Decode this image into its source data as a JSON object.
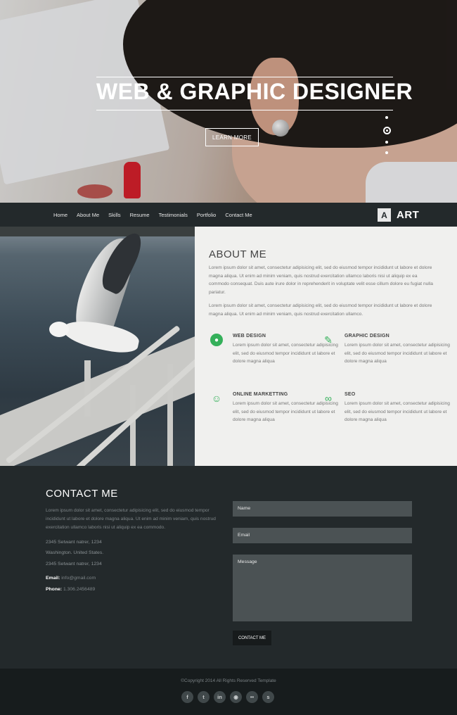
{
  "hero": {
    "title": "WEB & GRAPHIC DESIGNER",
    "button_label": "LEARN MORE",
    "slider_dots": 4,
    "active_dot": 1
  },
  "nav": {
    "items": [
      "Home",
      "About Me",
      "Skills",
      "Resume",
      "Testimonials",
      "Portfolio",
      "Contact Me"
    ],
    "logo_mark": "A",
    "logo_word": "ART"
  },
  "about": {
    "heading": "ABOUT ME",
    "paragraph1": "Lorem ipsum dolor sit amet, consectetur adipisicing elit, sed do eiusmod tempor incididunt ut labore et dolore magna aliqua. Ut enim ad minim veniam, quis nostrud exercitation ullamco laboris nisi ut aliquip ex ea commodo consequat. Duis aute irure dolor in reprehenderit in voluptate velit esse cillum dolore eu fugiat nulla pariatur.",
    "paragraph2": "Lorem ipsum dolor sit amet, consectetur adipisicing elit, sed do eiusmod tempor incididunt ut labore et dolore magna aliqua. Ut enim ad minim veniam, quis nostrud exercitation ullamco.",
    "features": [
      {
        "title": "WEB DESIGN",
        "text": "Lorem ipsum dolor sit amet, consectetur adipisicing elit, sed do eiusmod tempor incididunt ut labore et dolore magna aliqua",
        "icon": "globe-icon"
      },
      {
        "title": "GRAPHIC DESIGN",
        "text": "Lorem ipsum dolor sit amet, consectetur adipisicing elit, sed do eiusmod tempor incididunt ut labore et dolore magna aliqua",
        "icon": "pen-icon"
      },
      {
        "title": "ONLINE MARKETTING",
        "text": "Lorem ipsum dolor sit amet, consectetur adipisicing elit, sed do eiusmod tempor incididunt ut labore et dolore magna aliqua",
        "icon": "people-icon"
      },
      {
        "title": "SEO",
        "text": "Lorem ipsum dolor sit amet, consectetur adipisicing elit, sed do eiusmod tempor incididunt ut labore et dolore magna aliqua",
        "icon": "swirl-icon"
      }
    ]
  },
  "contact": {
    "heading": "CONTACT ME",
    "intro": "Lorem ipsum dolor sit amet, consectetur adipisicing elit, sed do eiusmod tempor incididunt ut labore et dolore magna aliqua. Ut enim ad minim veniam, quis nostrud exercitation ullamco laboris nisi ut aliquip ex ea commodo.",
    "address_line1": "2345 Setwant natrer, 1234",
    "address_line2": "Washington. United States.",
    "address_line3": "2345 Setwant natrer, 1234",
    "email_label": "Email:",
    "email_value": "info@gmail.com",
    "phone_label": "Phone:",
    "phone_value": "1.306.2456489",
    "name_placeholder": "Name",
    "email_placeholder": "Email",
    "message_placeholder": "Message",
    "send_label": "CONTACT ME"
  },
  "footer": {
    "copyright": "©Copyright 2014 All Rights Reserved Template",
    "socials": [
      "facebook-icon",
      "twitter-icon",
      "linkedin-icon",
      "dribbble-icon",
      "flickr-icon",
      "skype-icon"
    ]
  },
  "colors": {
    "accent": "#35b05a",
    "dark": "#23292b",
    "footer": "#171c1d",
    "about_bg": "#f0f0ee"
  }
}
